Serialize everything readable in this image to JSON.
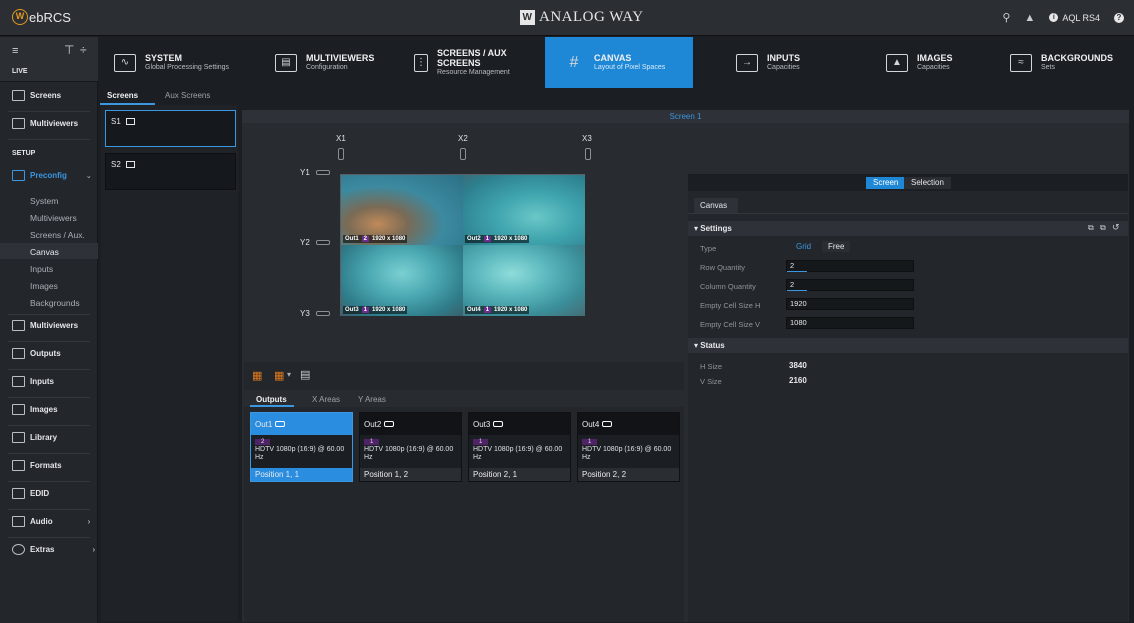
{
  "app": {
    "logo_text": "ebRCS",
    "logo_letter": "W",
    "brand": "ANALOG WAY",
    "brand_mark": "W",
    "device": "AQL RS4"
  },
  "left_nav": {
    "mode_label": "LIVE",
    "items_top": [
      {
        "label": "Screens",
        "icon": "screens-icon"
      },
      {
        "label": "Multiviewers",
        "icon": "multiviewer-icon"
      }
    ],
    "setup_label": "SETUP",
    "preconfig_label": "Preconfig",
    "sub_items": [
      "System",
      "Multiviewers",
      "Screens / Aux.",
      "Canvas",
      "Inputs",
      "Images",
      "Backgrounds"
    ],
    "items_bottom": [
      {
        "label": "Multiviewers",
        "icon": "multiviewer-icon"
      },
      {
        "label": "Outputs",
        "icon": "outputs-icon"
      },
      {
        "label": "Inputs",
        "icon": "inputs-icon"
      },
      {
        "label": "Images",
        "icon": "images-icon"
      },
      {
        "label": "Library",
        "icon": "library-icon"
      },
      {
        "label": "Formats",
        "icon": "formats-icon"
      },
      {
        "label": "EDID",
        "icon": "edid-icon"
      },
      {
        "label": "Audio",
        "icon": "audio-icon"
      },
      {
        "label": "Extras",
        "icon": "extras-icon"
      }
    ]
  },
  "top_tabs": [
    {
      "title": "SYSTEM",
      "title2": "",
      "sub": "Global Processing Settings"
    },
    {
      "title": "MULTIVIEWERS",
      "title2": "",
      "sub": "Configuration"
    },
    {
      "title": "SCREENS / AUX",
      "title2": "SCREENS",
      "sub": "Resource Management"
    },
    {
      "title": "CANVAS",
      "title2": "",
      "sub": "Layout of Pixel Spaces"
    },
    {
      "title": "INPUTS",
      "title2": "",
      "sub": "Capacities"
    },
    {
      "title": "IMAGES",
      "title2": "",
      "sub": "Capacities"
    },
    {
      "title": "BACKGROUNDS",
      "title2": "",
      "sub": "Sets"
    }
  ],
  "screen_tabs": [
    "Screens",
    "Aux Screens"
  ],
  "screen_cards": [
    "S1",
    "S2"
  ],
  "screen_title": "Screen 1",
  "canvas": {
    "x_labels": [
      "X1",
      "X2",
      "X3"
    ],
    "y_labels": [
      "Y1",
      "Y2",
      "Y3"
    ],
    "cells": [
      {
        "out": "Out1",
        "num": "2",
        "res": "1920 x 1080"
      },
      {
        "out": "Out2",
        "num": "1",
        "res": "1920 x 1080"
      },
      {
        "out": "Out3",
        "num": "1",
        "res": "1920 x 1080"
      },
      {
        "out": "Out4",
        "num": "1",
        "res": "1920 x 1080"
      }
    ]
  },
  "output_tabs": [
    "Outputs",
    "X Areas",
    "Y Areas"
  ],
  "output_cards": [
    {
      "name": "Out1",
      "num": "2",
      "format": "HDTV 1080p (16:9) @ 60.00 Hz",
      "position": "Position 1, 1"
    },
    {
      "name": "Out2",
      "num": "1",
      "format": "HDTV 1080p (16:9) @ 60.00 Hz",
      "position": "Position 1, 2"
    },
    {
      "name": "Out3",
      "num": "1",
      "format": "HDTV 1080p (16:9) @ 60.00 Hz",
      "position": "Position 2, 1"
    },
    {
      "name": "Out4",
      "num": "1",
      "format": "HDTV 1080p (16:9) @ 60.00 Hz",
      "position": "Position 2, 2"
    }
  ],
  "right_panel": {
    "seg_screen": "Screen",
    "seg_selection": "Selection",
    "canvas_tab": "Canvas",
    "settings_title": "Settings",
    "type_label": "Type",
    "type_grid": "Grid",
    "type_free": "Free",
    "row_qty_label": "Row Quantity",
    "row_qty": "2",
    "col_qty_label": "Column Quantity",
    "col_qty": "2",
    "cell_h_label": "Empty Cell Size H",
    "cell_h": "1920",
    "cell_v_label": "Empty Cell Size V",
    "cell_v": "1080",
    "status_title": "Status",
    "hsize_label": "H Size",
    "hsize": "3840",
    "vsize_label": "V Size",
    "vsize": "2160"
  },
  "colors": {
    "accent": "#1e88d6",
    "badge": "#6b2e8f",
    "logo": "#e39a1f"
  }
}
